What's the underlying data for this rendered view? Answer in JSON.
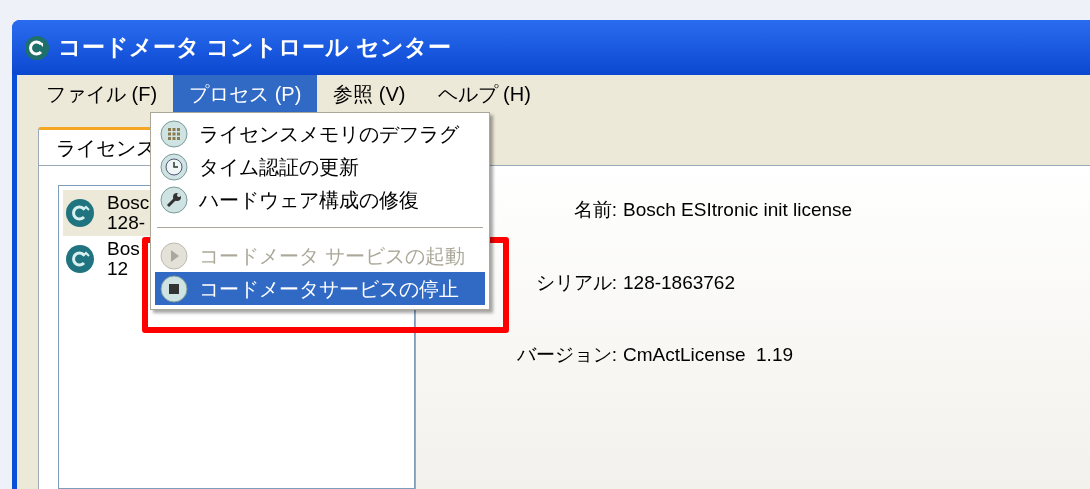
{
  "window": {
    "title": "コードメータ コントロール センター"
  },
  "menu_bar": [
    {
      "label": "ファイル (F)",
      "selected": false
    },
    {
      "label": "プロセス (P)",
      "selected": true
    },
    {
      "label": "参照 (V)",
      "selected": false
    },
    {
      "label": "ヘルプ (H)",
      "selected": false
    }
  ],
  "dropdown": [
    {
      "kind": "item",
      "label": "ライセンスメモリのデフラグ",
      "disabled": false,
      "selected": false
    },
    {
      "kind": "item",
      "label": "タイム認証の更新",
      "disabled": false,
      "selected": false
    },
    {
      "kind": "item",
      "label": "ハードウェア構成の修復",
      "disabled": false,
      "selected": false
    },
    {
      "kind": "separator"
    },
    {
      "kind": "item",
      "label": "コードメータ サービスの起動",
      "disabled": true,
      "selected": false
    },
    {
      "kind": "item",
      "label": "コードメータサービスの停止",
      "disabled": false,
      "selected": true
    }
  ],
  "tabs": [
    {
      "label": "ライセンス",
      "selected": true
    }
  ],
  "licenses": [
    {
      "name": "Bosc",
      "serial": "128-",
      "selected": true
    },
    {
      "name": "Bos",
      "serial": "12",
      "selected": false
    }
  ],
  "details": [
    {
      "label": "名前:",
      "value": "Bosch ESItronic init license"
    },
    {
      "label": "シリアル:",
      "value": "128-1863762"
    },
    {
      "label": "バージョン:",
      "value": "CmActLicense  1.19"
    }
  ],
  "annotation": {
    "kind": "frame"
  }
}
